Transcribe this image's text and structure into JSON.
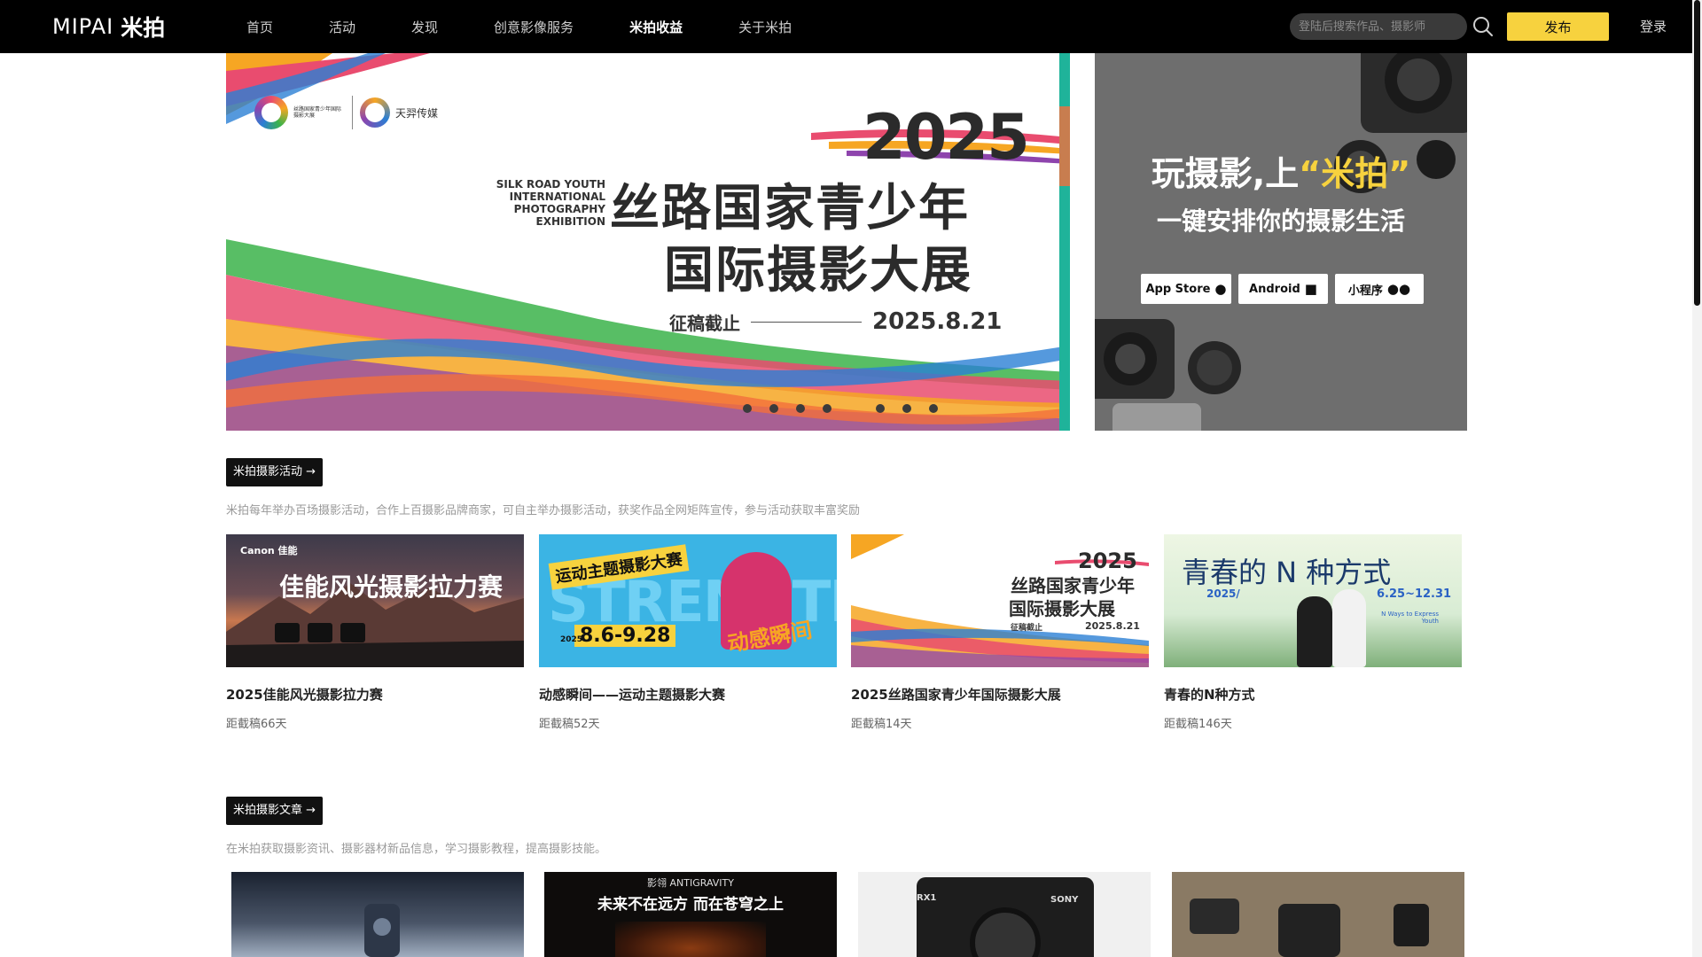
{
  "header": {
    "logo_latin": "MIPAI",
    "logo_cn": "米拍",
    "nav": [
      "首页",
      "活动",
      "发现",
      "创意影像服务",
      "米拍收益",
      "关于米拍"
    ],
    "nav_active_index": 4,
    "search_placeholder": "登陆后搜索作品、摄影师",
    "publish_label": "发布",
    "login_label": "登录"
  },
  "hero": {
    "org_name": "丝路国家青少年国际摄影大展",
    "org_name_en": "SILK ROAD YOUTH INTERNATIONAL PHOTOGRAPHY EXHIBITION",
    "media_name": "天羿传媒",
    "year": "2025",
    "title_en_line1": "SILK ROAD YOUTH",
    "title_en_line2": "INTERNATIONAL PHOTOGRAPHY",
    "title_en_line3": "EXHIBITION",
    "title_cn_line1": "丝路国家青少年",
    "title_cn_line2": "国际摄影大展",
    "deadline_label": "征稿截止",
    "deadline_date": "2025.8.21",
    "dots_count": 8,
    "active_dot_index": 4
  },
  "side": {
    "title_prefix": "玩摄影,上",
    "title_highlight": "米拍",
    "subtitle": "一键安排你的摄影生活",
    "app_store": "App Store",
    "android": "Android",
    "mini_program": "小程序"
  },
  "activities": {
    "tag": "米拍摄影活动 →",
    "desc": "米拍每年举办百场摄影活动，合作上百摄影品牌商家，可自主举办摄影活动，获奖作品全网矩阵宣传，参与活动获取丰富奖励",
    "items": [
      {
        "title": "2025佳能风光摄影拉力赛",
        "meta": "距截稿66天",
        "img_brand": "Canon 佳能",
        "img_title": "佳能风光摄影拉力赛"
      },
      {
        "title": "动感瞬间——运动主题摄影大赛",
        "meta": "距截稿52天",
        "img_title": "运动主题摄影大赛",
        "img_dates": "8.6-9.28",
        "img_year": "2025",
        "img_bg_word": "STRENGTH",
        "img_slogan": "动感瞬间"
      },
      {
        "title": "2025丝路国家青少年国际摄影大展",
        "meta": "距截稿14天",
        "img_year": "2025",
        "img_title1": "丝路国家青少年",
        "img_title2": "国际摄影大展",
        "img_deadline": "征稿截止",
        "img_date": "2025.8.21"
      },
      {
        "title": "青春的N种方式",
        "meta": "距截稿146天",
        "img_title": "青春的 N 种方式",
        "img_year": "2025/",
        "img_dates": "6.25~12.31",
        "img_en": "N Ways to Express Youth"
      }
    ]
  },
  "articles": {
    "tag": "米拍摄影文章 →",
    "desc": "在米拍获取摄影资讯、摄影器材新品信息，学习摄影教程，提高摄影技能。",
    "items": [
      {
        "img_text": ""
      },
      {
        "img_brand": "影翎 ANTIGRAVITY",
        "img_text": "未来不在远方 而在苍穹之上"
      },
      {
        "img_model": "RX1",
        "img_brand": "SONY"
      },
      {
        "img_text": ""
      }
    ]
  },
  "colors": {
    "accent": "#f7d23e",
    "header_bg": "#000000",
    "side_bg": "#6e6e6e"
  }
}
